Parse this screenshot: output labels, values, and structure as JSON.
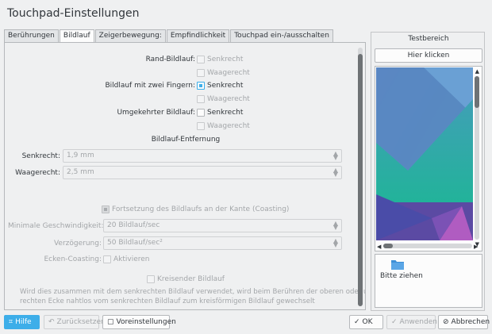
{
  "window": {
    "title": "Touchpad-Einstellungen"
  },
  "tabs": [
    {
      "label": "Berührungen"
    },
    {
      "label": "Bildlauf"
    },
    {
      "label": "Zeigerbewegung:"
    },
    {
      "label": "Empfindlichkeit"
    },
    {
      "label": "Touchpad ein-/ausschalten"
    }
  ],
  "scrolling": {
    "edge": {
      "label": "Rand-Bildlauf:",
      "vertical": "Senkrecht",
      "horizontal": "Waagerecht"
    },
    "two_finger": {
      "label": "Bildlauf mit zwei Fingern:",
      "vertical": "Senkrecht",
      "horizontal": "Waagerecht"
    },
    "reverse": {
      "label": "Umgekehrter Bildlauf:",
      "vertical": "Senkrecht",
      "horizontal": "Waagerecht"
    },
    "distance_heading": "Bildlauf-Entfernung",
    "vertical_label": "Senkrecht:",
    "vertical_value": "1,9 mm",
    "horizontal_label": "Waagerecht:",
    "horizontal_value": "2,5 mm",
    "coasting": "Fortsetzung des Bildlaufs an der Kante (Coasting)",
    "min_speed_label": "Minimale Geschwindigkeit:",
    "min_speed_value": "20 Bildlauf/sec",
    "decel_label": "Verzögerung:",
    "decel_value": "50 Bildlauf/sec²",
    "corner_label": "Ecken-Coasting:",
    "corner_check": "Aktivieren",
    "circular": "Kreisender Bildlauf",
    "circular_desc_1": "Wird dies zusammen mit dem senkrechten Bildlauf verwendet, wird beim Berühren der oberen oder unteren",
    "circular_desc_2": "rechten Ecke nahtlos vom senkrechten Bildlauf zum kreisförmigen Bildlauf gewechselt"
  },
  "test_area": {
    "title": "Testbereich",
    "click_button": "Hier klicken",
    "drag_label": "Bitte ziehen"
  },
  "footer": {
    "help": "Hilfe",
    "reset": "Zurücksetzen",
    "defaults": "Voreinstellungen",
    "ok": "OK",
    "apply": "Anwenden",
    "cancel": "Abbrechen"
  },
  "colors": {
    "accent": "#3daee9",
    "background": "#eff0f1"
  }
}
